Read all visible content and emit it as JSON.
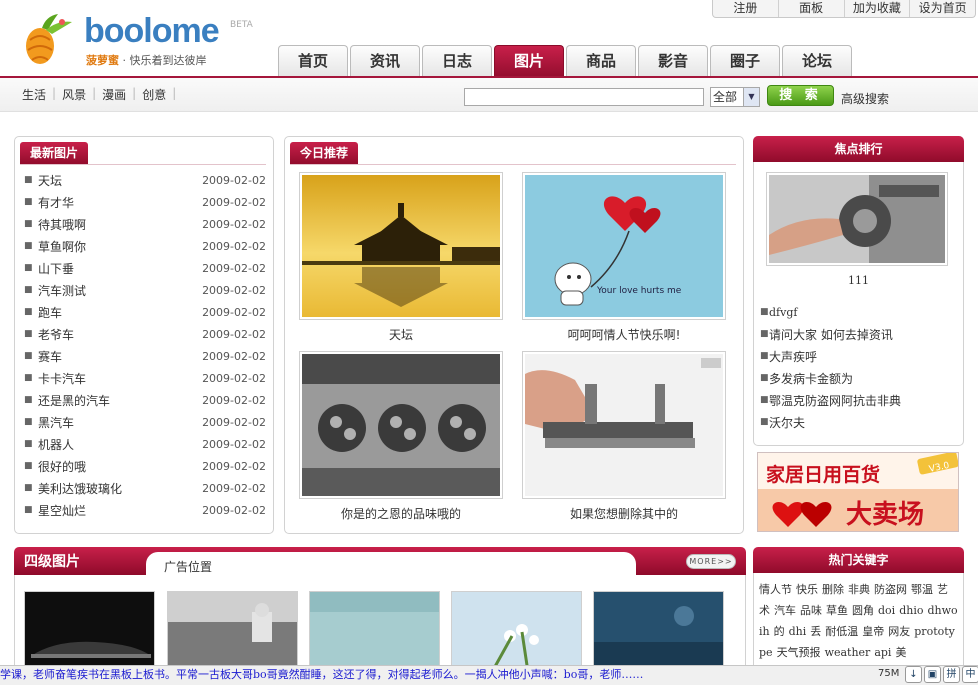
{
  "header": {
    "logo_text": "boolome",
    "logo_beta": "BETA",
    "slogan_brand": "菠萝蜜",
    "slogan_text": "· 快乐着到达彼岸",
    "top_links": [
      "注册",
      "面板",
      "加为收藏",
      "设为首页"
    ],
    "tabs": [
      {
        "label": "首页",
        "active": false
      },
      {
        "label": "资讯",
        "active": false
      },
      {
        "label": "日志",
        "active": false
      },
      {
        "label": "图片",
        "active": true
      },
      {
        "label": "商品",
        "active": false
      },
      {
        "label": "影音",
        "active": false
      },
      {
        "label": "圈子",
        "active": false
      },
      {
        "label": "论坛",
        "active": false
      }
    ],
    "colors": {
      "accent": "#a5163b",
      "search_button": "#5aa91e"
    }
  },
  "subnav": {
    "items": [
      "生活",
      "风景",
      "漫画",
      "创意"
    ],
    "search": {
      "value": "",
      "scope": "全部",
      "button_label": "搜 索",
      "advanced_label": "高级搜索"
    }
  },
  "latest": {
    "title": "最新图片",
    "items": [
      {
        "title": "天坛",
        "date": "2009-02-02"
      },
      {
        "title": "有才华",
        "date": "2009-02-02"
      },
      {
        "title": "待其哦啊",
        "date": "2009-02-02"
      },
      {
        "title": "草鱼啊你",
        "date": "2009-02-02"
      },
      {
        "title": "山下垂",
        "date": "2009-02-02"
      },
      {
        "title": "汽车测试",
        "date": "2009-02-02"
      },
      {
        "title": "跑车",
        "date": "2009-02-02"
      },
      {
        "title": "老爷车",
        "date": "2009-02-02"
      },
      {
        "title": "赛车",
        "date": "2009-02-02"
      },
      {
        "title": "卡卡汽车",
        "date": "2009-02-02"
      },
      {
        "title": "还是黑的汽车",
        "date": "2009-02-02"
      },
      {
        "title": "黑汽车",
        "date": "2009-02-02"
      },
      {
        "title": "机器人",
        "date": "2009-02-02"
      },
      {
        "title": "很好的哦",
        "date": "2009-02-02"
      },
      {
        "title": "美利达饿玻璃化",
        "date": "2009-02-02"
      },
      {
        "title": "星空灿烂",
        "date": "2009-02-02"
      }
    ]
  },
  "recommend": {
    "title": "今日推荐",
    "items": [
      {
        "caption": "天坛"
      },
      {
        "caption": "呵呵呵情人节快乐啊!"
      },
      {
        "caption": "你是的之恩的品味哦的"
      },
      {
        "caption": "如果您想删除其中的"
      }
    ],
    "balloon_text": "Your love hurts me"
  },
  "focus": {
    "title": "焦点排行",
    "top_caption": "111",
    "items": [
      "dfvgf",
      "请问大家 如何去掉资讯",
      "大声疾呼",
      "多发病卡金额为",
      "鄂温克防盗网阿抗击非典",
      "沃尔夫"
    ]
  },
  "ad_banner": {
    "line1": "家居日用百货",
    "line2": "大卖场",
    "badge": "V3.0"
  },
  "level4": {
    "title": "四级图片",
    "ad_label": "广告位置",
    "more_label": "MORE>>"
  },
  "hot": {
    "title": "热门关键字",
    "words": [
      "情人节",
      "快乐",
      "删除",
      "非典",
      "防盗网",
      "鄂温",
      "艺术",
      "汽车",
      "品味",
      "草鱼",
      "圆角",
      "doi",
      "dhio",
      "dhwoih",
      "的",
      "dhi",
      "丢",
      "耐低温",
      "皇帝",
      "网友",
      "prototype",
      "天气预报",
      "weather",
      "api",
      "美"
    ]
  },
  "status": {
    "marquee": "学课，老师奋笔疾书在黑板上板书。平常一古板大哥bo哥竟然酣睡，这还了得，对得起老师么。一揭人冲他小声喊：bo哥，老师……",
    "memory": "75M",
    "icons": [
      "arrow-down-icon",
      "window-icon",
      "ime-icon",
      "chinese-icon"
    ],
    "icon_glyphs": [
      "↓",
      "▣",
      "拼",
      "中"
    ]
  }
}
